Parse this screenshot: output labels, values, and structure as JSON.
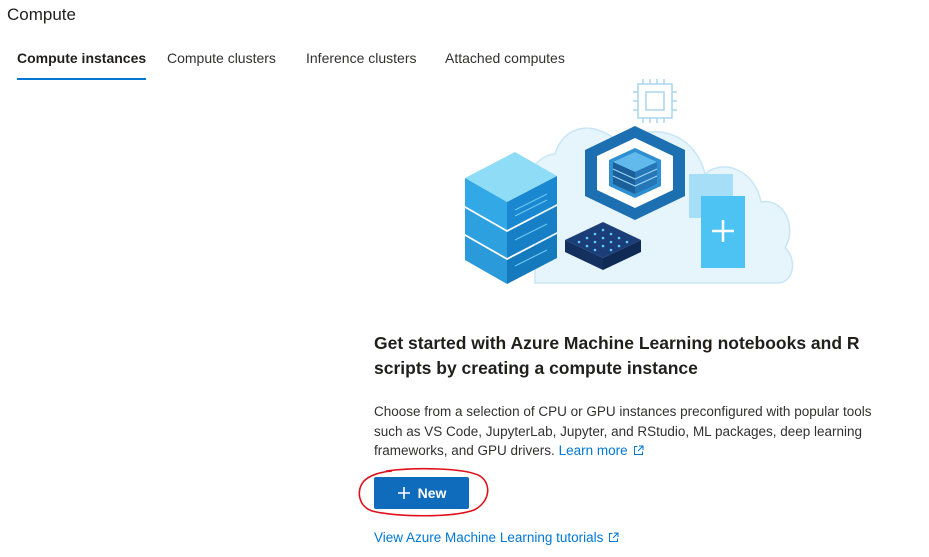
{
  "page": {
    "title": "Compute"
  },
  "tabs": [
    {
      "label": "Compute instances",
      "active": true
    },
    {
      "label": "Compute clusters",
      "active": false
    },
    {
      "label": "Inference clusters",
      "active": false
    },
    {
      "label": "Attached computes",
      "active": false
    }
  ],
  "empty_state": {
    "headline": "Get started with Azure Machine Learning notebooks and R scripts by creating a compute instance",
    "description": "Choose from a selection of CPU or GPU instances preconfigured with popular tools such as VS Code, JupyterLab, Jupyter, and RStudio, ML packages, deep learning frameworks, and GPU drivers.",
    "learn_more_label": "Learn more",
    "new_button_label": "New",
    "tutorials_link_label": "View Azure Machine Learning tutorials"
  },
  "icons": {
    "learn_more": "external-link-icon",
    "new_button": "plus-icon",
    "tutorials": "external-link-icon"
  },
  "colors": {
    "accent": "#0078d4",
    "primary_button": "#0f6cbd",
    "annotation": "#e0101a"
  }
}
